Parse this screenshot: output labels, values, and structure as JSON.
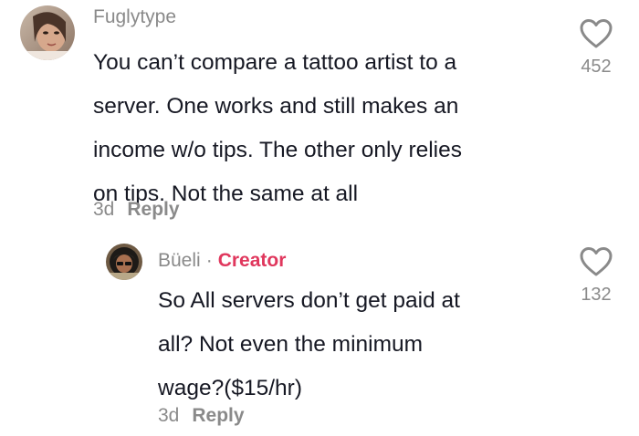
{
  "comments": [
    {
      "username": "Fuglytype",
      "lines": [
        "You can’t compare a tattoo artist to a",
        "server. One works and still makes an",
        "income w/o tips. The other only relies",
        "on tips. Not the same at all"
      ],
      "time": "3d",
      "reply_label": "Reply",
      "likes": "452",
      "avatar_icon": "user-avatar"
    }
  ],
  "replies": [
    {
      "username": "Büeli",
      "separator": "·",
      "badge": "Creator",
      "badge_color": "#e0375d",
      "lines": [
        "So All servers don’t get paid at",
        "all? Not even the minimum",
        "wage?($15/hr)"
      ],
      "time": "3d",
      "reply_label": "Reply",
      "likes": "132",
      "avatar_icon": "user-avatar"
    }
  ],
  "icons": {
    "like": "heart-outline-icon"
  }
}
